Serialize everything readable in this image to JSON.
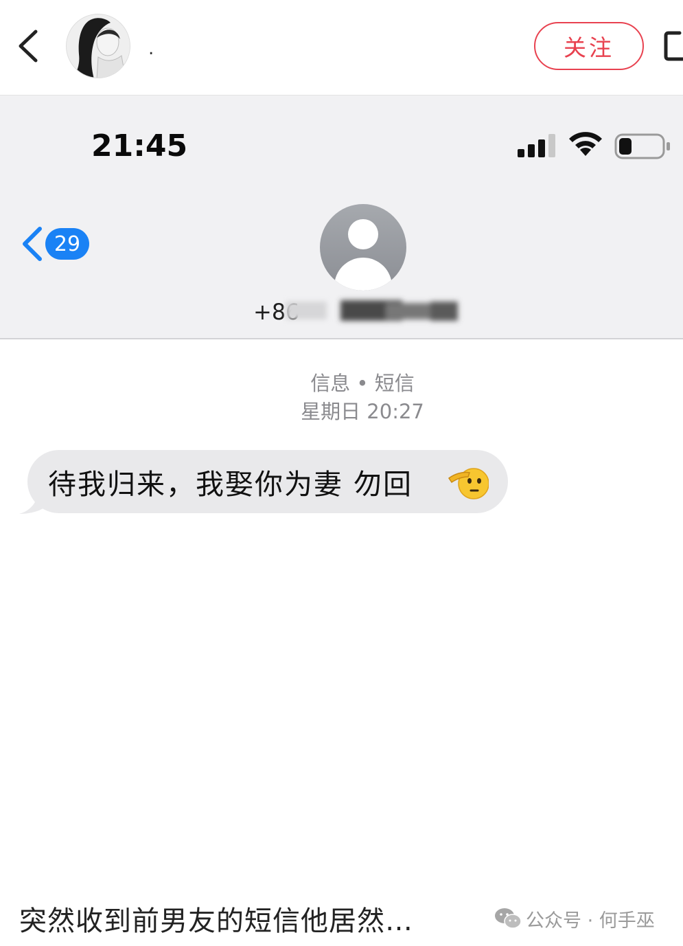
{
  "app_bar": {
    "author_name": ".",
    "follow_label": "关注"
  },
  "phone": {
    "status_time": "21:45",
    "unread_count": "29",
    "contact_number_prefix": "+86"
  },
  "conversation": {
    "meta_line1": "信息 • 短信",
    "meta_line2": "星期日 20:27",
    "message_text": "待我归来，我娶你为妻 勿回",
    "message_emoji": "salute-face"
  },
  "footer": {
    "caption": "突然收到前男友的短信他居然…",
    "source": "公众号 · 何手巫"
  },
  "icons": [
    "back-chevron-icon",
    "share-icon",
    "signal-icon",
    "wifi-icon",
    "battery-icon",
    "person-silhouette-icon",
    "salute-emoji-icon",
    "wechat-icon"
  ],
  "colors": {
    "follow_accent": "#e8414f",
    "ios_blue": "#1a82f5",
    "bubble_gray": "#e9e9eb",
    "header_bg": "#f1f1f3"
  },
  "battery_level": 0.3,
  "signal_bars_active": 3
}
